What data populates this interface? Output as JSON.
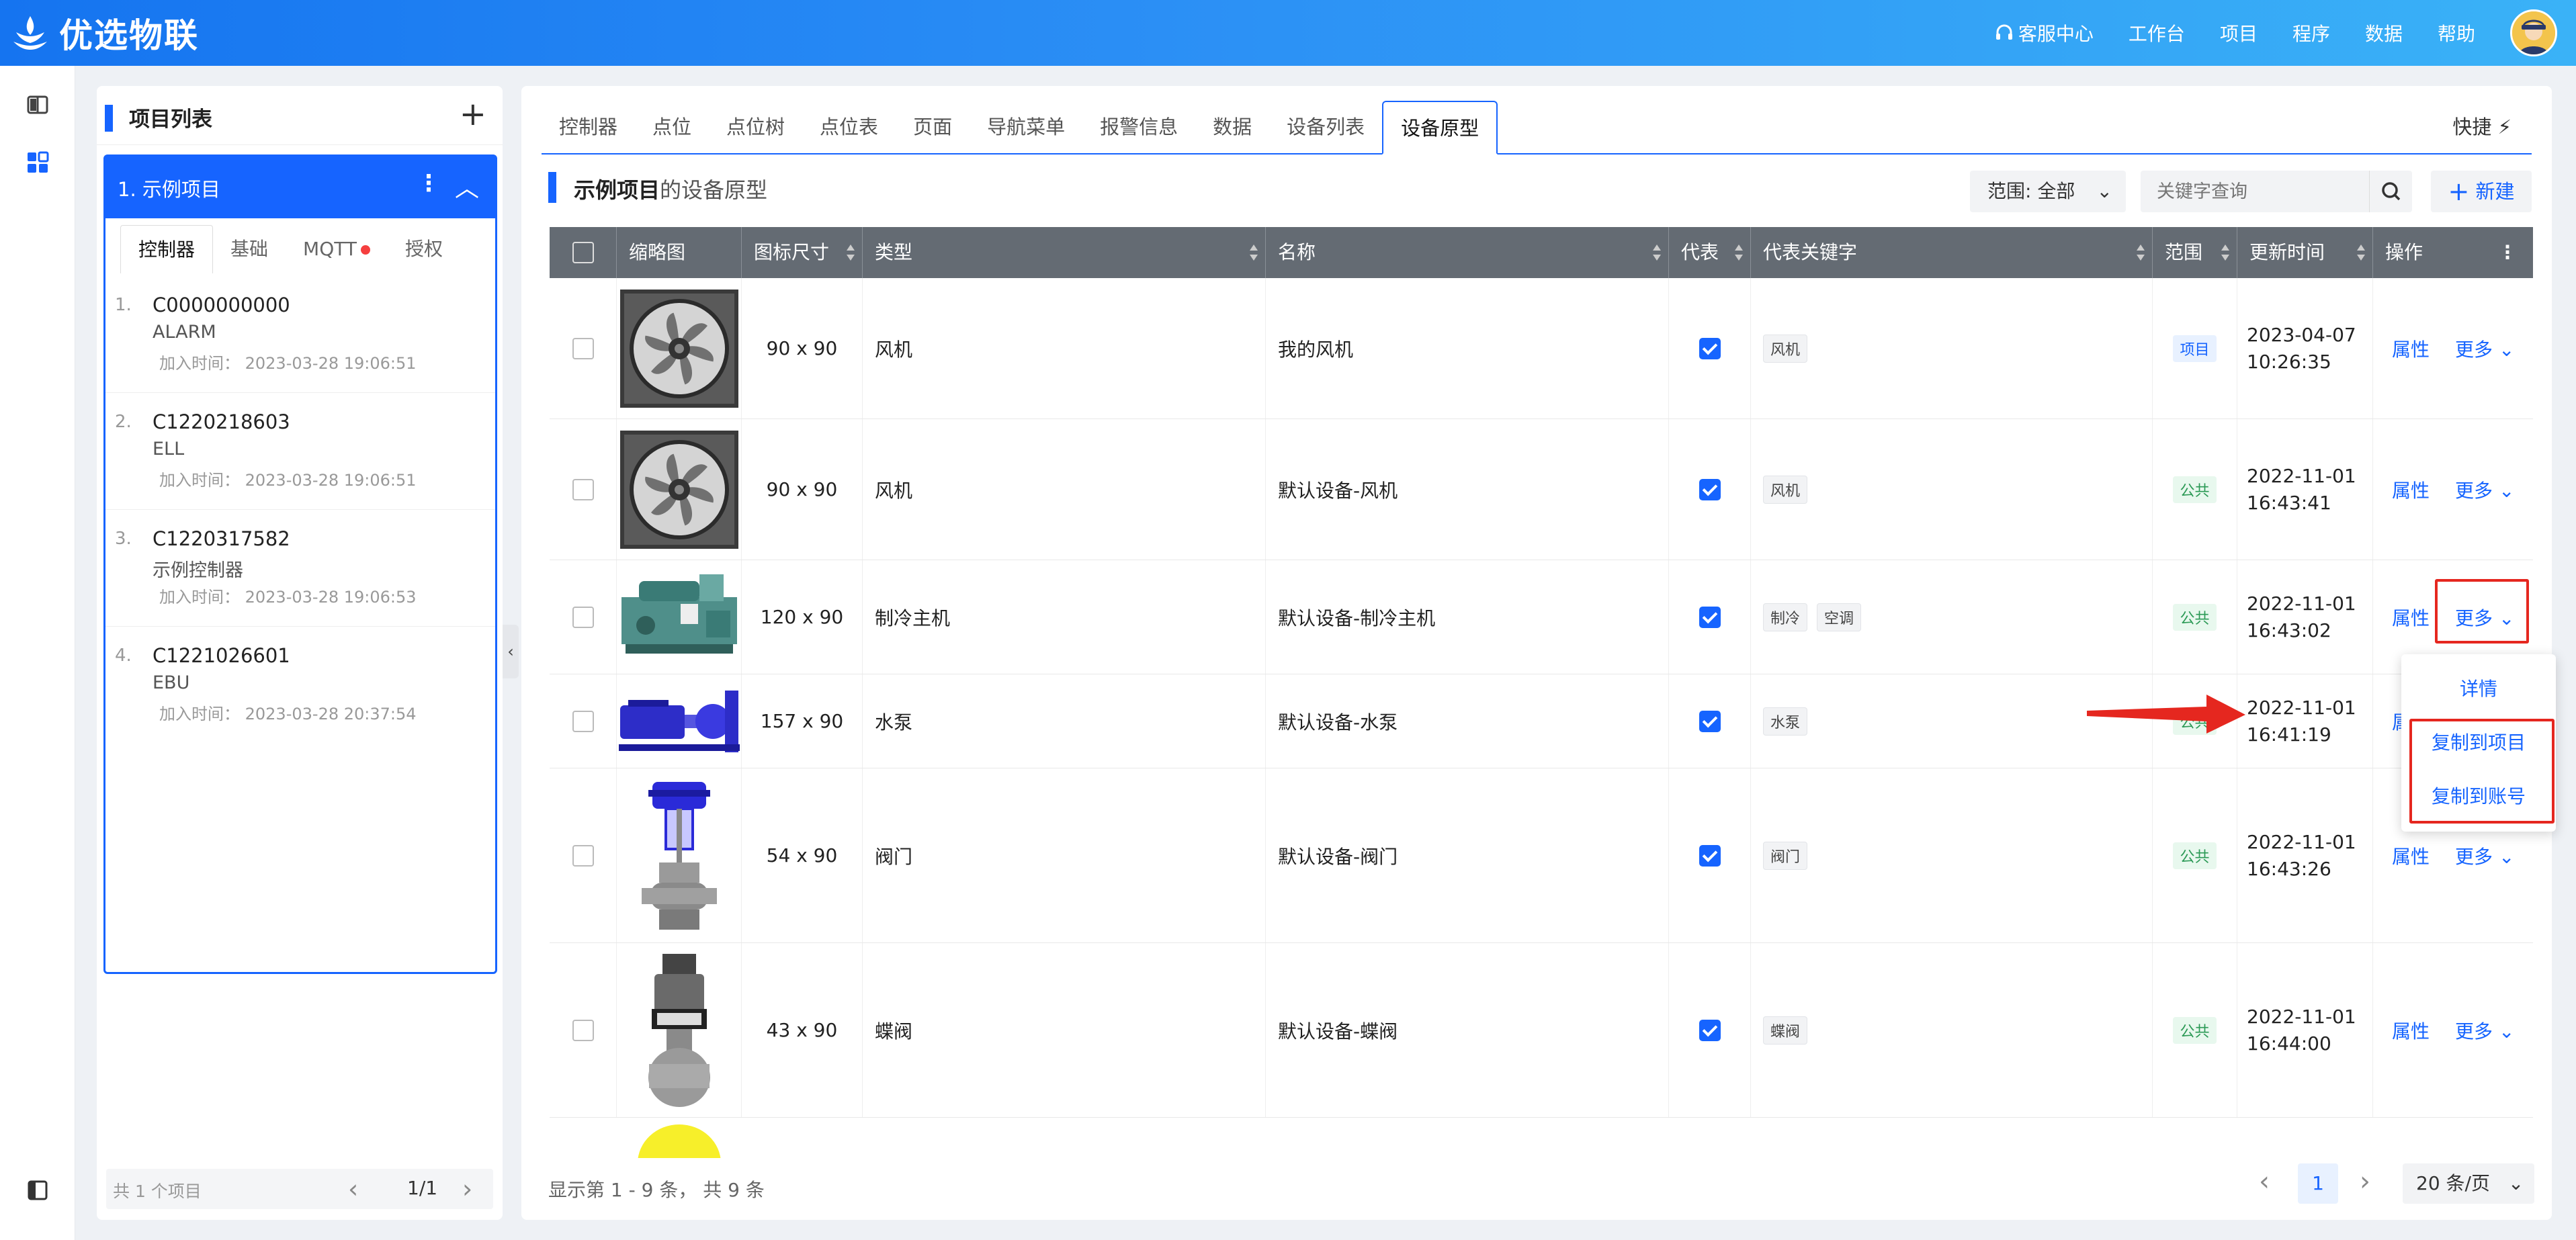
{
  "app": {
    "title": "优选物联"
  },
  "topnav": {
    "service": "客服中心",
    "workbench": "工作台",
    "project": "项目",
    "program": "程序",
    "data": "数据",
    "help": "帮助"
  },
  "project_panel": {
    "title": "项目列表",
    "active_project": "1. 示例项目",
    "subtabs": [
      "控制器",
      "基础",
      "MQTT",
      "授权"
    ],
    "controllers": [
      {
        "num": "1.",
        "id": "C0000000000",
        "type": "ALARM",
        "time": "加入时间： 2023-03-28 19:06:51"
      },
      {
        "num": "2.",
        "id": "C1220218603",
        "type": "ELL",
        "time": "加入时间： 2023-03-28 19:06:51"
      },
      {
        "num": "3.",
        "id": "C1220317582",
        "type": "示例控制器",
        "time": "加入时间： 2023-03-28 19:06:53"
      },
      {
        "num": "4.",
        "id": "C1221026601",
        "type": "EBU",
        "time": "加入时间： 2023-03-28 20:37:54"
      }
    ],
    "footer": {
      "count": "共 1 个项目",
      "page": "1/1"
    }
  },
  "main": {
    "tabs": [
      "控制器",
      "点位",
      "点位树",
      "点位表",
      "页面",
      "导航菜单",
      "报警信息",
      "数据",
      "设备列表",
      "设备原型"
    ],
    "quick": "快捷",
    "section_title_bold": "示例项目",
    "section_title_rest": "的设备原型",
    "range": "范围: 全部",
    "search_placeholder": "关键字查询",
    "new_label": "新建",
    "columns": [
      "缩略图",
      "图标尺寸",
      "类型",
      "名称",
      "代表",
      "代表关键字",
      "范围",
      "更新时间",
      "操作"
    ],
    "rows": [
      {
        "size": "90 x 90",
        "type": "风机",
        "name": "我的风机",
        "keywords": [
          "风机"
        ],
        "scope": "项目",
        "date": "2023-04-07",
        "time": "10:26:35"
      },
      {
        "size": "90 x 90",
        "type": "风机",
        "name": "默认设备-风机",
        "keywords": [
          "风机"
        ],
        "scope": "公共",
        "date": "2022-11-01",
        "time": "16:43:41"
      },
      {
        "size": "120 x 90",
        "type": "制冷主机",
        "name": "默认设备-制冷主机",
        "keywords": [
          "制冷",
          "空调"
        ],
        "scope": "公共",
        "date": "2022-11-01",
        "time": "16:43:02"
      },
      {
        "size": "157 x 90",
        "type": "水泵",
        "name": "默认设备-水泵",
        "keywords": [
          "水泵"
        ],
        "scope": "公共",
        "date": "2022-11-01",
        "time": "16:41:19"
      },
      {
        "size": "54 x 90",
        "type": "阀门",
        "name": "默认设备-阀门",
        "keywords": [
          "阀门"
        ],
        "scope": "公共",
        "date": "2022-11-01",
        "time": "16:43:26"
      },
      {
        "size": "43 x 90",
        "type": "蝶阀",
        "name": "默认设备-蝶阀",
        "keywords": [
          "蝶阀"
        ],
        "scope": "公共",
        "date": "2022-11-01",
        "time": "16:44:00"
      }
    ],
    "action_attr": "属性",
    "action_more": "更多",
    "dropdown": [
      "详情",
      "复制到项目",
      "复制到账号"
    ],
    "footer_info": "显示第 1 - 9 条， 共 9 条",
    "page": "1",
    "page_size": "20 条/页"
  },
  "colors": {
    "primary": "#1664ff",
    "header_start": "#1574f0",
    "header_end": "#3ab2f7",
    "annotation_red": "#e5271f"
  }
}
